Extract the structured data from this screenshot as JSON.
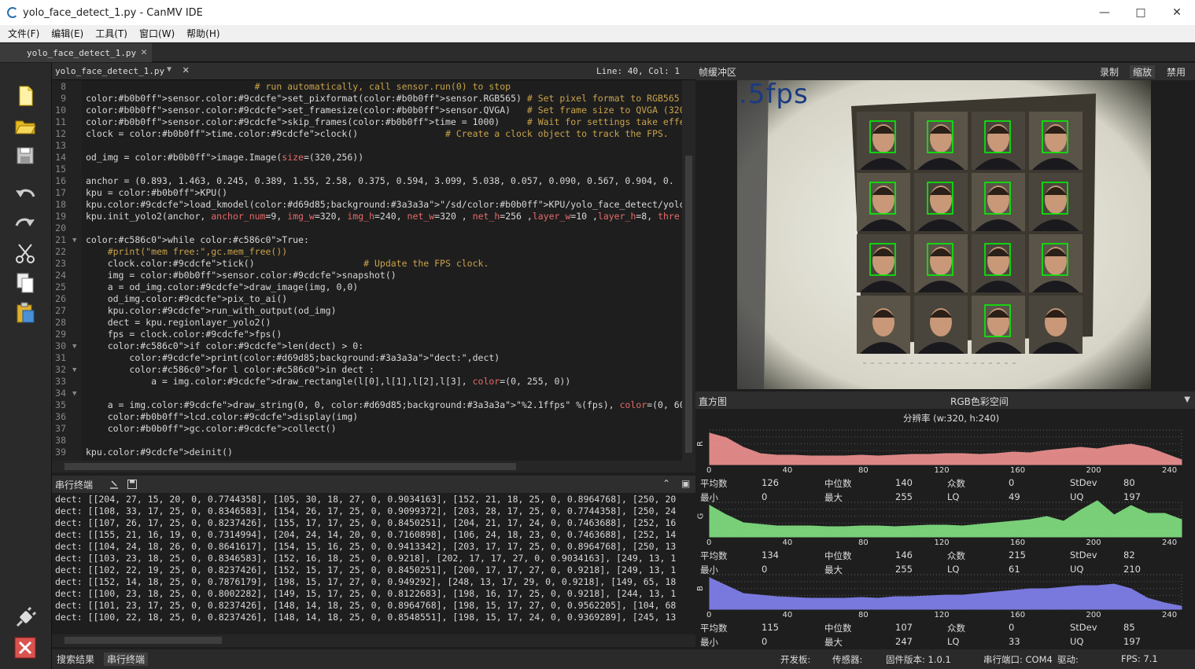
{
  "window": {
    "title": "yolo_face_detect_1.py - CanMV IDE"
  },
  "menu": [
    "文件(F)",
    "编辑(E)",
    "工具(T)",
    "窗口(W)",
    "帮助(H)"
  ],
  "doc_tab": {
    "label": "yolo_face_detect_1.py"
  },
  "editor": {
    "file": "yolo_face_detect_1.py",
    "position": "Line: 40, Col: 1",
    "line_numbers": [
      "8",
      "9",
      "10",
      "11",
      "12",
      "13",
      "14",
      "15",
      "16",
      "17",
      "18",
      "19",
      "20",
      "21",
      "22",
      "23",
      "24",
      "25",
      "26",
      "27",
      "28",
      "29",
      "30",
      "31",
      "32",
      "33",
      "34",
      "35",
      "36",
      "37",
      "38",
      "39"
    ],
    "lines": [
      "                               # run automatically, call sensor.run(0) to stop",
      "sensor.set_pixformat(sensor.RGB565) # Set pixel format to RGB565 (or GRAYSCALE)",
      "sensor.set_framesize(sensor.QVGA)   # Set frame size to QVGA (320x240)",
      "sensor.skip_frames(time = 1000)     # Wait for settings take effect.",
      "clock = time.clock()                # Create a clock object to track the FPS.",
      "",
      "od_img = image.Image(size=(320,256))",
      "",
      "anchor = (0.893, 1.463, 0.245, 0.389, 1.55, 2.58, 0.375, 0.594, 3.099, 5.038, 0.057, 0.090, 0.567, 0.904, 0.",
      "kpu = KPU()",
      "kpu.load_kmodel(\"/sd/KPU/yolo_face_detect/yolo_face_detect.kmodel\")",
      "kpu.init_yolo2(anchor, anchor_num=9, img_w=320, img_h=240, net_w=320 , net_h=256 ,layer_w=10 ,layer_h=8, thre",
      "",
      "while True:",
      "    #print(\"mem free:\",gc.mem_free())",
      "    clock.tick()                    # Update the FPS clock.",
      "    img = sensor.snapshot()",
      "    a = od_img.draw_image(img, 0,0)",
      "    od_img.pix_to_ai()",
      "    kpu.run_with_output(od_img)",
      "    dect = kpu.regionlayer_yolo2()",
      "    fps = clock.fps()",
      "    if len(dect) > 0:",
      "        print(\"dect:\",dect)",
      "        for l in dect :",
      "            a = img.draw_rectangle(l[0],l[1],l[2],l[3], color=(0, 255, 0))",
      "",
      "    a = img.draw_string(0, 0, \"%2.1ffps\" %(fps), color=(0, 60, 128), scale=2.0)",
      "    lcd.display(img)",
      "    gc.collect()",
      "",
      "kpu.deinit()"
    ]
  },
  "terminal": {
    "title": "串行终端",
    "lines": [
      "dect: [[204, 27, 15, 20, 0, 0.7744358], [105, 30, 18, 27, 0, 0.9034163], [152, 21, 18, 25, 0, 0.8964768], [250, 20",
      "dect: [[108, 33, 17, 25, 0, 0.8346583], [154, 26, 17, 25, 0, 0.9099372], [203, 28, 17, 25, 0, 0.7744358], [250, 24",
      "dect: [[107, 26, 17, 25, 0, 0.8237426], [155, 17, 17, 25, 0, 0.8450251], [204, 21, 17, 24, 0, 0.7463688], [252, 16",
      "dect: [[155, 21, 16, 19, 0, 0.7314994], [204, 24, 14, 20, 0, 0.7160898], [106, 24, 18, 23, 0, 0.7463688], [252, 14",
      "dect: [[104, 24, 18, 26, 0, 0.8641617], [154, 15, 16, 25, 0, 0.9413342], [203, 17, 17, 25, 0, 0.8964768], [250, 13",
      "dect: [[103, 23, 18, 25, 0, 0.8346583], [152, 16, 18, 25, 0, 0.9218], [202, 17, 17, 27, 0, 0.9034163], [249, 13, 1",
      "dect: [[102, 22, 19, 25, 0, 0.8237426], [152, 15, 17, 25, 0, 0.8450251], [200, 17, 17, 27, 0, 0.9218], [249, 13, 1",
      "dect: [[152, 14, 18, 25, 0, 0.7876179], [198, 15, 17, 27, 0, 0.949292], [248, 13, 17, 29, 0, 0.9218], [149, 65, 18",
      "dect: [[100, 23, 18, 25, 0, 0.8002282], [149, 15, 17, 25, 0, 0.8122683], [198, 16, 17, 25, 0, 0.9218], [244, 13, 1",
      "dect: [[101, 23, 17, 25, 0, 0.8237426], [148, 14, 18, 25, 0, 0.8964768], [198, 15, 17, 27, 0, 0.9562205], [104, 68",
      "dect: [[100, 22, 18, 25, 0, 0.8237426], [148, 14, 18, 25, 0, 0.8548551], [198, 15, 17, 24, 0, 0.9369289], [245, 13"
    ]
  },
  "bottom_tabs": [
    "搜索结果",
    "串行终端"
  ],
  "framebuffer": {
    "title": "帧缓冲区",
    "buttons": [
      "录制",
      "缩放",
      "禁用"
    ],
    "overlay_text": ".5fps"
  },
  "histogram": {
    "title": "直方图",
    "colorspace": "RGB色彩空间",
    "resolution": "分辨率 (w:320, h:240)",
    "axis_ticks": [
      "0",
      "40",
      "80",
      "120",
      "160",
      "200",
      "240"
    ],
    "channels": [
      {
        "name": "R",
        "color": "#ff9999",
        "stats": {
          "平均数": "126",
          "中位数": "140",
          "众数": "0",
          "StDev": "80",
          "最小": "0",
          "最大": "255",
          "LQ": "49",
          "UQ": "197"
        }
      },
      {
        "name": "G",
        "color": "#88ee88",
        "stats": {
          "平均数": "134",
          "中位数": "146",
          "众数": "215",
          "StDev": "82",
          "最小": "0",
          "最大": "255",
          "LQ": "61",
          "UQ": "210"
        }
      },
      {
        "name": "B",
        "color": "#8888ff",
        "stats": {
          "平均数": "115",
          "中位数": "107",
          "众数": "0",
          "StDev": "85",
          "最小": "0",
          "最大": "247",
          "LQ": "33",
          "UQ": "197"
        }
      }
    ]
  },
  "statusbar": {
    "board": "开发板:",
    "sensor": "传感器:",
    "firmware": "固件版本: 1.0.1",
    "port": "串行端口: COM4",
    "driver": "驱动:",
    "fps": "FPS:  7.1"
  }
}
